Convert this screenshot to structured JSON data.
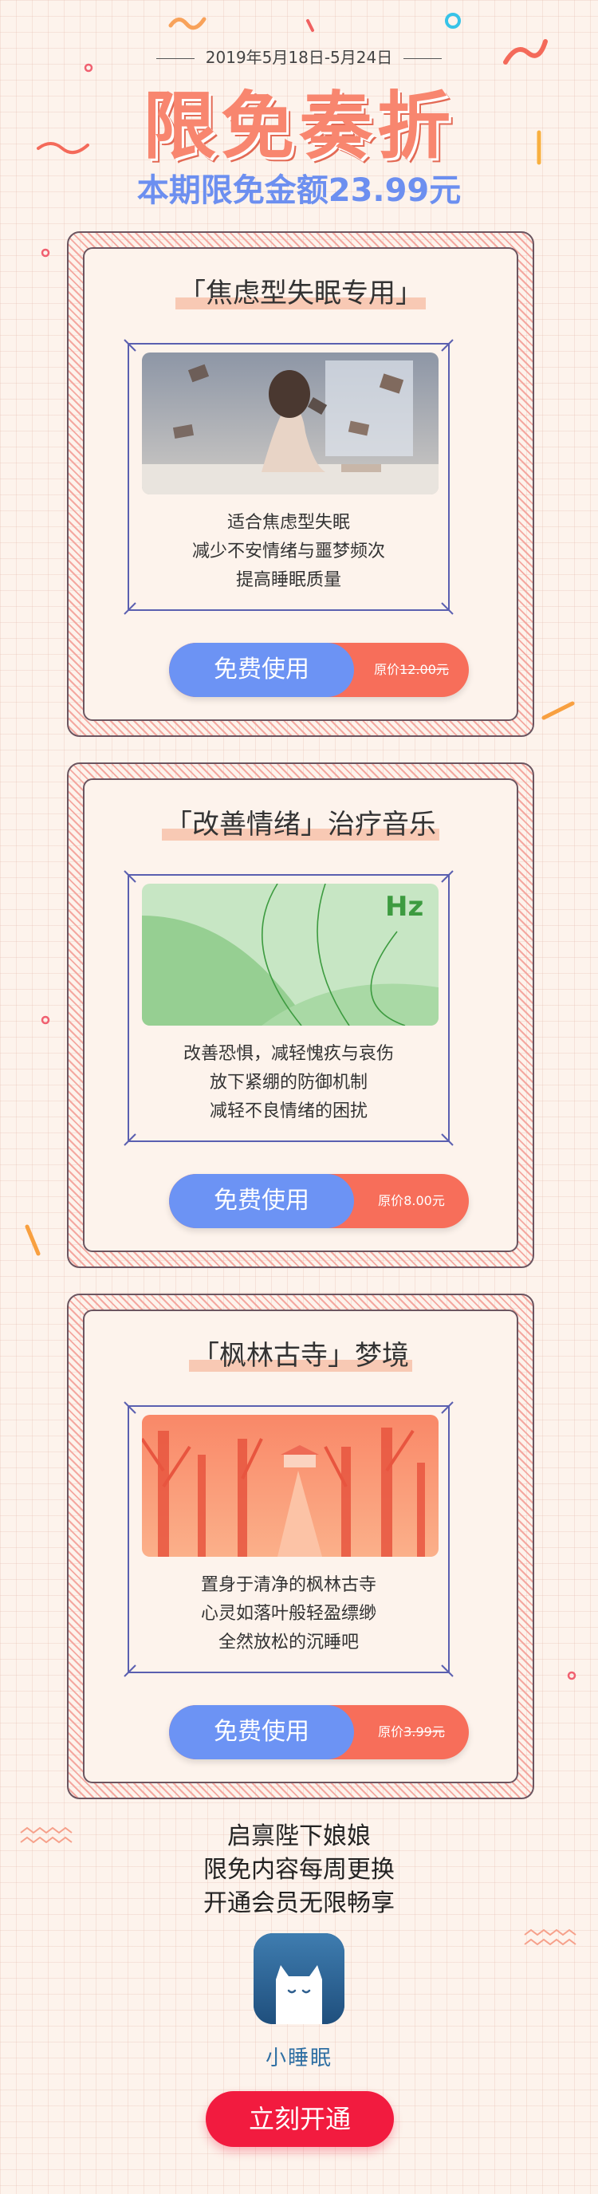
{
  "header": {
    "date_range": "2019年5月18日-5月24日",
    "title": "限免奏折",
    "subtitle": "本期限免金额23.99元"
  },
  "cards": [
    {
      "title": "「焦虑型失眠专用」",
      "desc": [
        "适合焦虑型失眠",
        "减少不安情绪与噩梦频次",
        "提高睡眠质量"
      ],
      "button_label": "免费使用",
      "price_label": "原价",
      "price": "12.00元",
      "price_struck": true
    },
    {
      "title": "「改善情绪」治疗音乐",
      "image_text": "Hz",
      "desc": [
        "改善恐惧，减轻愧疚与哀伤",
        "放下紧绷的防御机制",
        "减轻不良情绪的困扰"
      ],
      "button_label": "免费使用",
      "price_label": "原价",
      "price": "8.00元",
      "price_struck": false
    },
    {
      "title": "「枫林古寺」梦境",
      "desc": [
        "置身于清净的枫林古寺",
        "心灵如落叶般轻盈缥缈",
        "全然放松的沉睡吧"
      ],
      "button_label": "免费使用",
      "price_label": "原价",
      "price": "3.99元",
      "price_struck": true
    }
  ],
  "footer": {
    "lines": [
      "启禀陛下娘娘",
      "限免内容每周更换",
      "开通会员无限畅享"
    ],
    "app_name": "小睡眠",
    "cta_label": "立刻开通"
  },
  "colors": {
    "accent_blue": "#6c93f4",
    "accent_orange": "#f76e5a",
    "cta_red": "#f21b3f",
    "title_coral": "#f8866f"
  }
}
